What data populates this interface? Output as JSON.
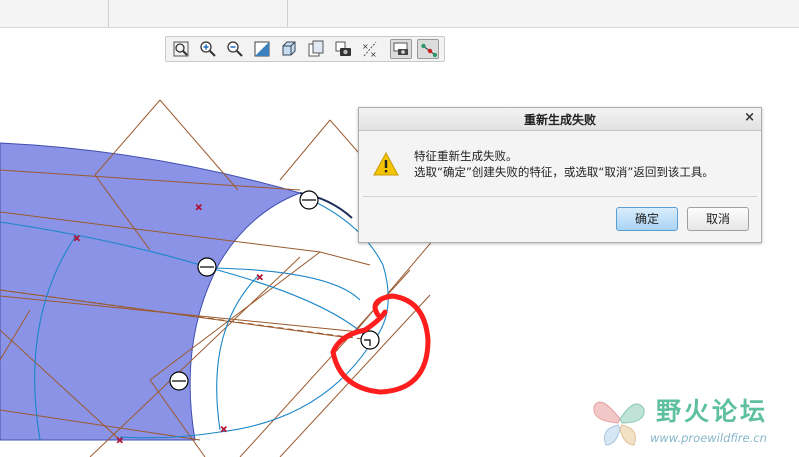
{
  "toolbar": {
    "buttons": [
      {
        "name": "refit-icon"
      },
      {
        "name": "zoom-in-icon"
      },
      {
        "name": "zoom-out-icon"
      },
      {
        "name": "repaint-icon"
      },
      {
        "name": "display-style-icon"
      },
      {
        "name": "saved-views-icon"
      },
      {
        "name": "layers-camera-icon"
      },
      {
        "name": "annotation-display-icon"
      },
      {
        "name": "datum-display-icon",
        "active": true
      },
      {
        "name": "spin-center-icon",
        "active": true
      }
    ]
  },
  "dialog": {
    "title": "重新生成失败",
    "close_symbol": "×",
    "message_line1": "特征重新生成失败。",
    "message_line2": "选取“确定”创建失败的特征，或选取“取消”返回到该工具。",
    "ok_label": "确定",
    "cancel_label": "取消"
  },
  "watermark": {
    "name": "野火论坛",
    "url": "www.proewildfire.cn"
  },
  "colors": {
    "surface": "#8b93e6",
    "datum_lines": "#9b5a2e",
    "curves": "#1a86c9",
    "annotation": "#ff1e1e",
    "ok_button": "#a9d4f5"
  }
}
